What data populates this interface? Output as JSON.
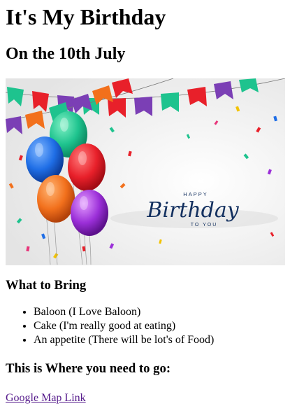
{
  "title": "It's My Birthday",
  "date": "On the 10th July",
  "banner": {
    "happy": "HAPPY",
    "birthday": "Birthday",
    "to_you": "TO YOU",
    "colors": {
      "navy": "#13305f",
      "green": "#1ec38e",
      "red": "#e8202a",
      "orange": "#f2701c",
      "blue": "#1f6ee6",
      "purple": "#9b2fd8",
      "violet": "#7b3fb5",
      "pink": "#e7357a"
    }
  },
  "bring": {
    "heading": "What to Bring",
    "items": [
      "Baloon (I Love Baloon)",
      "Cake (I'm really good at eating)",
      "An appetite (There will be lot's of Food)"
    ]
  },
  "where": {
    "heading": "This is Where you need to go:",
    "link_label": "Google Map Link"
  }
}
